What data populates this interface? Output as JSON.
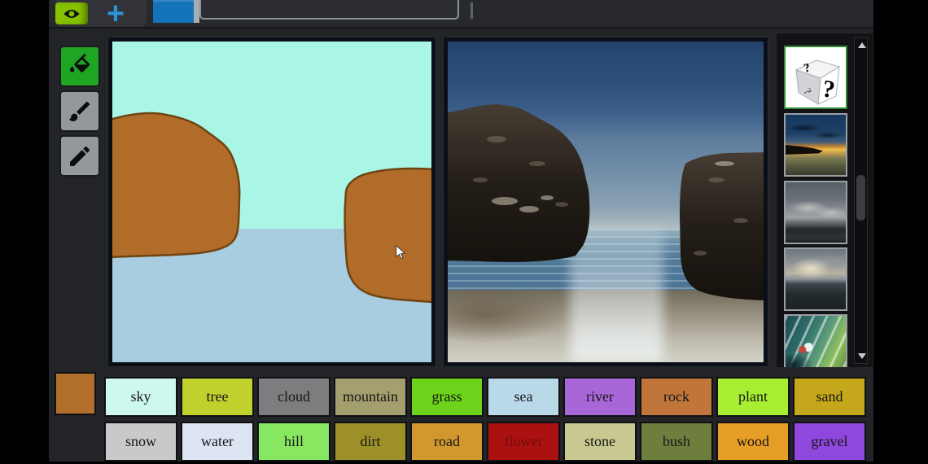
{
  "topbar": {
    "add_label": "+"
  },
  "tools": {
    "selected": "fill",
    "items": [
      {
        "name": "fill"
      },
      {
        "name": "brush"
      },
      {
        "name": "pencil"
      }
    ]
  },
  "palette": {
    "current_color": "#b26f2c",
    "rows": [
      [
        {
          "label": "sky",
          "color": "#cdf8ef"
        },
        {
          "label": "tree",
          "color": "#c0d02d"
        },
        {
          "label": "cloud",
          "color": "#7e7c7e"
        },
        {
          "label": "mountain",
          "color": "#a49f6e"
        },
        {
          "label": "grass",
          "color": "#6cd31a"
        },
        {
          "label": "sea",
          "color": "#b9d9e9"
        },
        {
          "label": "river",
          "color": "#a767d8"
        },
        {
          "label": "rock",
          "color": "#c0763a"
        },
        {
          "label": "plant",
          "color": "#a8ee33"
        },
        {
          "label": "sand",
          "color": "#c5a71b"
        }
      ],
      [
        {
          "label": "snow",
          "color": "#cac8cb"
        },
        {
          "label": "water",
          "color": "#dde4f3"
        },
        {
          "label": "hill",
          "color": "#87e761"
        },
        {
          "label": "dirt",
          "color": "#9e9029"
        },
        {
          "label": "road",
          "color": "#d2982f"
        },
        {
          "label": "flower",
          "color": "#ac1111",
          "text_color": "#6e0c0c"
        },
        {
          "label": "stone",
          "color": "#c7c991"
        },
        {
          "label": "bush",
          "color": "#6e7e3d"
        },
        {
          "label": "wood",
          "color": "#e69e26"
        },
        {
          "label": "gravel",
          "color": "#8f48dd"
        }
      ]
    ]
  },
  "styles": {
    "selected": "random-dice",
    "dice_marks": [
      "?",
      "?",
      "?"
    ],
    "items": [
      {
        "name": "random-dice",
        "art": "dice"
      },
      {
        "name": "sunset-beach",
        "art": "sunset"
      },
      {
        "name": "storm-clouds",
        "art": "storm"
      },
      {
        "name": "sun-through-clouds",
        "art": "rays"
      },
      {
        "name": "painterly-coast",
        "art": "painterly"
      }
    ]
  },
  "canvas": {
    "segmentation": {
      "sky_color": "#aaf6e6",
      "sea_color": "#a8cce0",
      "rock_fill": "#b06c28",
      "rock_outline": "#6f4410",
      "regions": [
        "sky",
        "sea",
        "rock",
        "rock"
      ]
    }
  }
}
